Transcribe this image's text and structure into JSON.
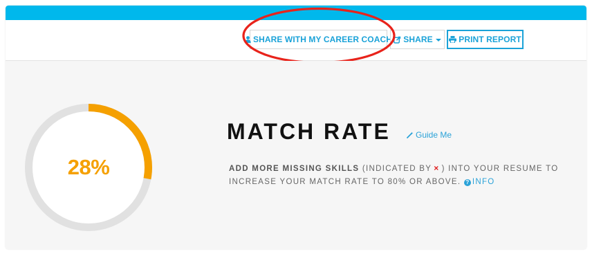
{
  "toolbar": {
    "share_coach_label": "SHARE WITH MY CAREER COACH",
    "share_label": "SHARE",
    "print_label": "PRINT REPORT"
  },
  "match": {
    "percent_label": "28%",
    "percent_value": 0.28,
    "title": "MATCH RATE",
    "guide_label": "Guide Me",
    "desc_strong": "ADD MORE MISSING SKILLS",
    "desc_part1": "(INDICATED BY",
    "desc_x": "×",
    "desc_part2": ") INTO YOUR RESUME TO INCREASE YOUR MATCH RATE TO 80% OR ABOVE.",
    "info_label": "INFO"
  },
  "colors": {
    "brand_bar": "#00b8ec",
    "link": "#1aa2d8",
    "gauge_fill": "#f5a000",
    "gauge_track": "#e1e1e1",
    "missing_x": "#e02020",
    "annotation_ellipse": "#e8231b"
  }
}
